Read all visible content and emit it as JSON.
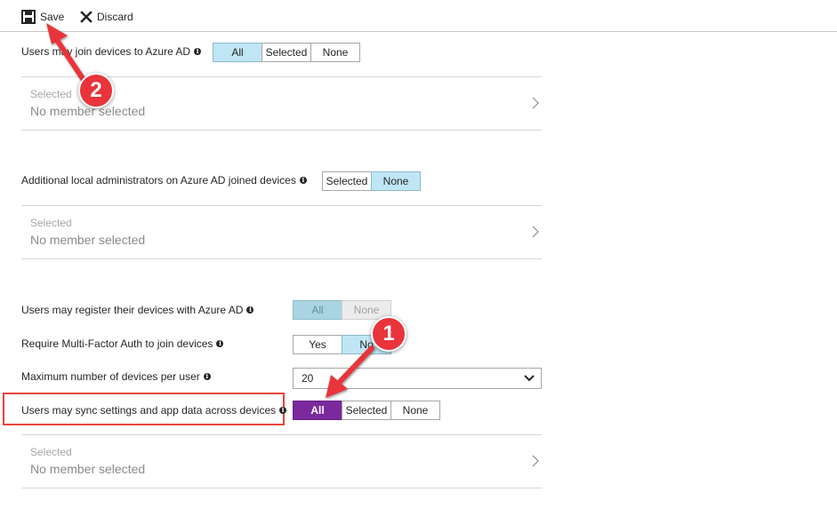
{
  "toolbar": {
    "save_label": "Save",
    "discard_label": "Discard",
    "save_icon": "floppy-disk",
    "discard_icon": "x-mark"
  },
  "settings": {
    "join": {
      "label": "Users may join devices to Azure AD",
      "options": [
        "All",
        "Selected",
        "None"
      ],
      "selected": "All"
    },
    "join_picker": {
      "small": "Selected",
      "big": "No member selected"
    },
    "local_admins": {
      "label": "Additional local administrators on Azure AD joined devices",
      "options": [
        "Selected",
        "None"
      ],
      "selected": "None"
    },
    "local_admins_picker": {
      "small": "Selected",
      "big": "No member selected"
    },
    "register": {
      "label": "Users may register their devices with Azure AD",
      "options": [
        "All",
        "None"
      ],
      "selected": "All",
      "disabled": true
    },
    "mfa": {
      "label": "Require Multi-Factor Auth to join devices",
      "options": [
        "Yes",
        "No"
      ],
      "selected": "No"
    },
    "max_devices": {
      "label": "Maximum number of devices per user",
      "value": "20"
    },
    "sync": {
      "label": "Users may sync settings and app data across devices",
      "options": [
        "All",
        "Selected",
        "None"
      ],
      "selected": "All"
    },
    "sync_picker": {
      "small": "Selected",
      "big": "No member selected"
    }
  },
  "annotations": {
    "callout_1": "1",
    "callout_2": "2"
  },
  "colors": {
    "accent_selected": "#bfe6f4",
    "sync_selected": "#7a2a9c",
    "callout_red": "#e8343a"
  }
}
